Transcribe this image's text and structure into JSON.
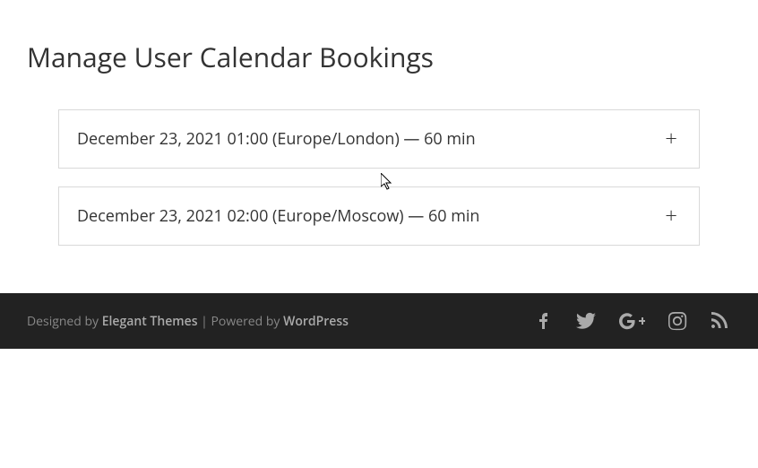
{
  "page": {
    "title": "Manage User Calendar Bookings"
  },
  "bookings": [
    {
      "label": "December 23, 2021 01:00 (Europe/London) — 60 min",
      "expand_symbol": "+"
    },
    {
      "label": "December 23, 2021 02:00 (Europe/Moscow) — 60 min",
      "expand_symbol": "+"
    }
  ],
  "footer": {
    "designed_by_prefix": "Designed by ",
    "designed_by_link": "Elegant Themes",
    "separator": " | Powered by ",
    "powered_by_link": "WordPress"
  }
}
